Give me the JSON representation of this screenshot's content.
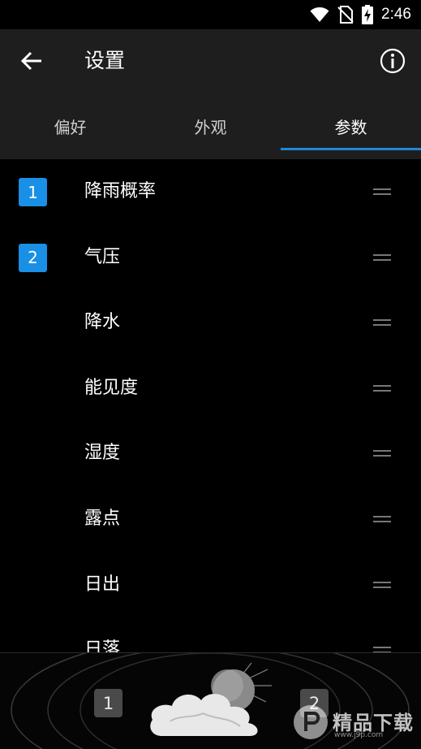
{
  "status_bar": {
    "time": "2:46",
    "icons": [
      "wifi-icon",
      "no-sim-icon",
      "battery-charging-icon"
    ]
  },
  "app_bar": {
    "title": "设置",
    "back_icon": "arrow-left-icon",
    "info_icon": "info-circle-icon"
  },
  "tabs": [
    {
      "label": "偏好",
      "active": false
    },
    {
      "label": "外观",
      "active": false
    },
    {
      "label": "参数",
      "active": true
    }
  ],
  "parameters": [
    {
      "label": "降雨概率",
      "badge": "1"
    },
    {
      "label": "气压",
      "badge": "2"
    },
    {
      "label": "降水",
      "badge": ""
    },
    {
      "label": "能见度",
      "badge": ""
    },
    {
      "label": "湿度",
      "badge": ""
    },
    {
      "label": "露点",
      "badge": ""
    },
    {
      "label": "日出",
      "badge": ""
    },
    {
      "label": "日落",
      "badge": ""
    }
  ],
  "bottom_widget": {
    "slot_left": "1",
    "slot_right": "2",
    "weather_icon": "partly-cloudy-night-icon"
  },
  "watermark": {
    "text": "精品下载",
    "sub": "www.j9p.com"
  },
  "colors": {
    "accent": "#1e88d8",
    "badge": "#1a8fe6",
    "app_bar_bg": "#1e1e1e",
    "background": "#000000"
  }
}
